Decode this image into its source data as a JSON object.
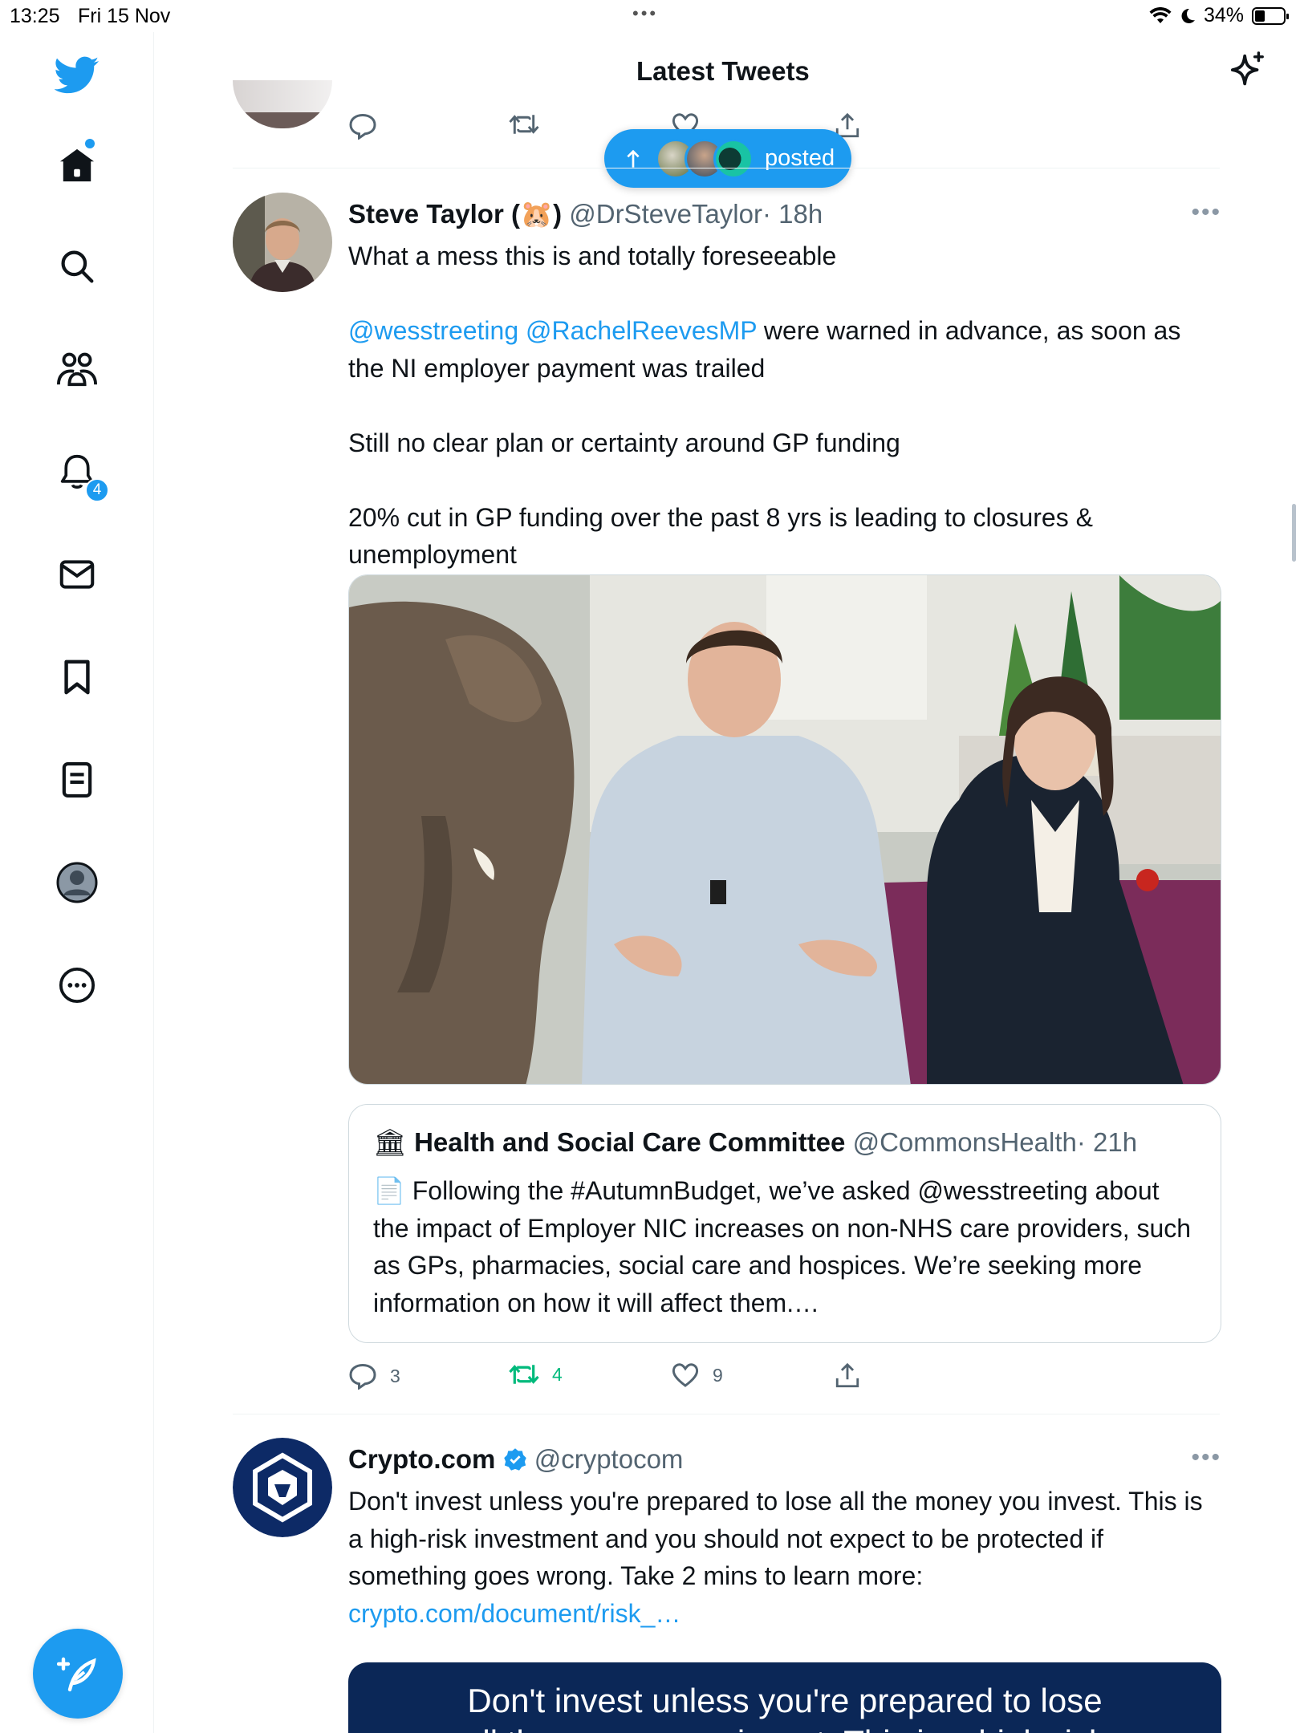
{
  "status_bar": {
    "time": "13:25",
    "date": "Fri 15 Nov",
    "battery": "34%",
    "battery_level": 0.34
  },
  "header": {
    "title": "Latest Tweets"
  },
  "sidebar": {
    "notification_count": "4",
    "items": [
      "home",
      "explore",
      "communities",
      "notifications",
      "messages",
      "bookmarks",
      "lists",
      "profile",
      "more"
    ]
  },
  "new_posts_pill": {
    "label": "posted"
  },
  "tweets": [
    {
      "name": "Steve Taylor (",
      "name_emoji": "🐹",
      "name_close": ")",
      "handle": "@DrSteveTaylor",
      "time": "· 18h",
      "line1": "What a mess this is and totally foreseeable",
      "mention1": "@wesstreeting",
      "mention2": "@RachelReevesMP",
      "line2_rest": " were warned in advance, as soon as the NI employer payment was trailed",
      "line3": "Still no clear plan or certainty around GP funding",
      "line4": "20% cut in GP funding over the past 8 yrs is leading to closures & unemployment",
      "quote": {
        "icon": "🏛",
        "name": "Health and Social Care Committee",
        "handle": "@CommonsHealth",
        "time": "· 21h",
        "body": "📄 Following the #AutumnBudget, we’ve asked @wesstreeting about the impact of Employer NIC increases on non-NHS care providers, such as GPs, pharmacies, social care and hospices. We’re seeking more information on how it will affect them.…"
      },
      "replies": "3",
      "retweets": "4",
      "likes": "9"
    },
    {
      "name": "Crypto.com",
      "handle": "@cryptocom",
      "body": "Don't invest unless you're prepared to lose all the money you invest. This is a high-risk investment and you should not expect to be protected if something goes wrong. Take 2 mins to learn more:",
      "link": "crypto.com/document/risk_…",
      "banner_line1": "Don't invest unless you're prepared to lose",
      "banner_line2": "all the money you invest. This is a high-risk"
    }
  ],
  "colors": {
    "accent": "#1d9bf0",
    "retweet": "#00ba7c",
    "text": "#0f1419",
    "muted": "#536471",
    "ad_banner": "#0b2757"
  }
}
